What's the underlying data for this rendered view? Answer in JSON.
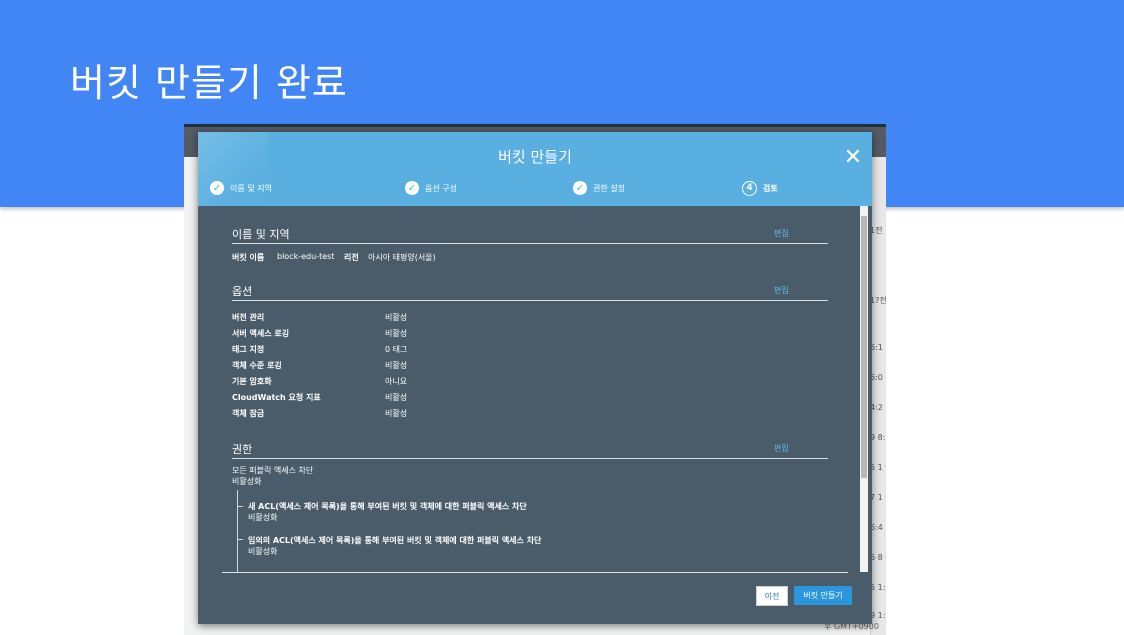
{
  "slide": {
    "title": "버킷 만들기 완료"
  },
  "background": {
    "timestamps": [
      "1전",
      "1?전",
      "6:1",
      "6:0",
      "4:2",
      "9 8:",
      "5 1\n900",
      "7 1\n900",
      "6:4",
      "6 8\n00",
      "5 1:",
      "9 1:"
    ],
    "bottom_text": "후 GMT+0900"
  },
  "modal": {
    "title": "버킷 만들기",
    "steps": [
      {
        "label": "이름 및 지역",
        "state": "done"
      },
      {
        "label": "옵션 구성",
        "state": "done"
      },
      {
        "label": "권한 설정",
        "state": "done"
      },
      {
        "label": "검토",
        "number": "4",
        "state": "current"
      }
    ],
    "sections": {
      "name_region": {
        "title": "이름 및 지역",
        "edit": "편집",
        "bucket_name_label": "버킷 이름",
        "bucket_name_value": "block-edu-test",
        "region_label": "리전",
        "region_value": "아시아 태평양(서울)"
      },
      "options": {
        "title": "옵션",
        "edit": "편집",
        "rows": [
          {
            "label": "버전 관리",
            "value": "비활성"
          },
          {
            "label": "서버 액세스 로깅",
            "value": "비활성"
          },
          {
            "label": "태그 지정",
            "value": "0 태그"
          },
          {
            "label": "객체 수준 로깅",
            "value": "비활성"
          },
          {
            "label": "기본 암호화",
            "value": "아니요"
          },
          {
            "label": "CloudWatch 요청 지표",
            "value": "비활성"
          },
          {
            "label": "객체 잠금",
            "value": "비활성"
          }
        ]
      },
      "permissions": {
        "title": "권한",
        "edit": "편집",
        "all_public_label": "모든 퍼블릭 액세스 차단",
        "all_public_value": "비활성화",
        "items": [
          {
            "label": "새 ACL(액세스 제어 목록)을 통해 부여된 버킷 및 객체에 대한 퍼블릭 액세스 차단",
            "value": "비활성화"
          },
          {
            "label": "임의의 ACL(액세스 제어 목록)을 통해 부여된 버킷 및 객체에 대한 퍼블릭 액세스 차단",
            "value": "비활성화"
          }
        ]
      }
    },
    "buttons": {
      "prev": "이전",
      "create": "버킷 만들기"
    }
  }
}
